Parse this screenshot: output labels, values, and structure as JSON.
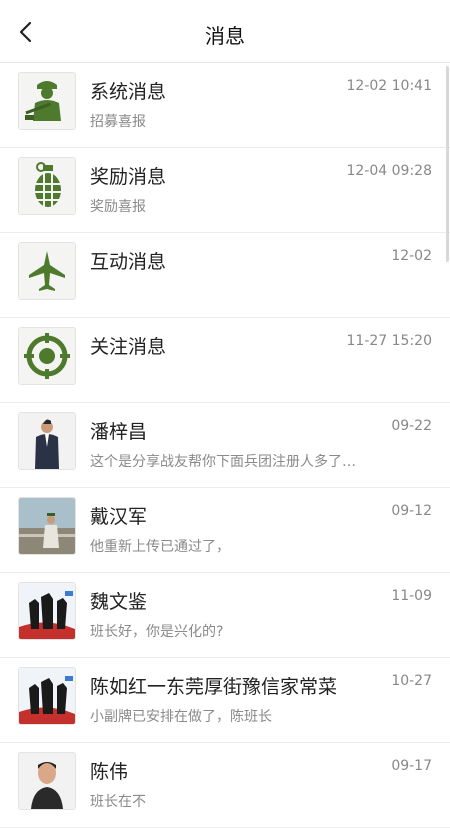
{
  "header": {
    "title": "消息",
    "back_icon": "chevron-left-icon"
  },
  "messages": [
    {
      "name": "系统消息",
      "time": "12-02 10:41",
      "preview": "招募喜报",
      "avatar": "soldier-icon"
    },
    {
      "name": "奖励消息",
      "time": "12-04 09:28",
      "preview": "奖励喜报",
      "avatar": "grenade-icon"
    },
    {
      "name": "互动消息",
      "time": "12-02",
      "preview": "",
      "avatar": "fighter-jet-icon"
    },
    {
      "name": "关注消息",
      "time": "11-27 15:20",
      "preview": "",
      "avatar": "target-icon"
    },
    {
      "name": "潘梓昌",
      "time": "09-22",
      "preview": "这个是分享战友帮你下面兵团注册人多了…",
      "avatar": "user-avatar-photo"
    },
    {
      "name": "戴汉军",
      "time": "09-12",
      "preview": "他重新上传已通过了，",
      "avatar": "user-avatar-photo"
    },
    {
      "name": "魏文鉴",
      "time": "11-09",
      "preview": "班长好，你是兴化的?",
      "avatar": "user-avatar-photo"
    },
    {
      "name": "陈如红一东莞厚街豫信家常菜",
      "time": "10-27",
      "preview": "小副牌已安排在做了，陈班长",
      "avatar": "user-avatar-photo"
    },
    {
      "name": "陈伟",
      "time": "09-17",
      "preview": "班长在不",
      "avatar": "user-avatar-photo"
    }
  ],
  "colors": {
    "icon_green": "#4e7a2e"
  }
}
